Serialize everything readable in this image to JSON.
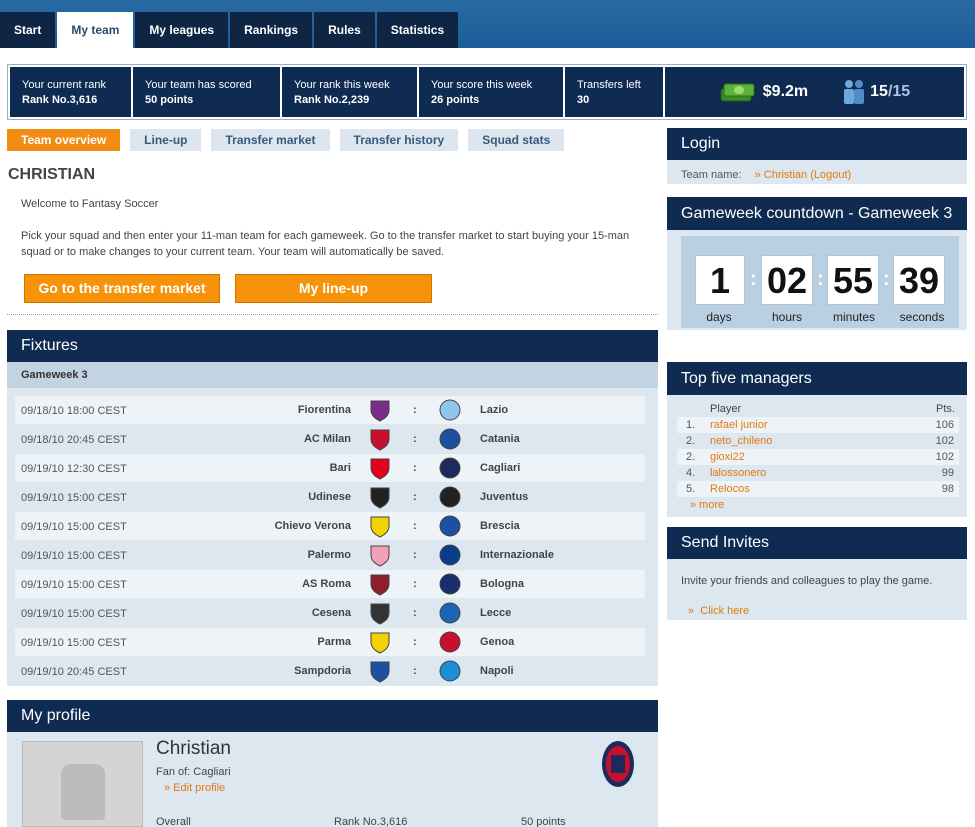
{
  "nav": {
    "tabs": [
      "Start",
      "My team",
      "My leagues",
      "Rankings",
      "Rules",
      "Statistics"
    ],
    "active": "My team"
  },
  "stats": {
    "current_rank_label": "Your current rank",
    "current_rank_value": "Rank No.3,616",
    "scored_label": "Your team has scored",
    "scored_value": "50 points",
    "week_rank_label": "Your rank this week",
    "week_rank_value": "Rank No.2,239",
    "week_score_label": "Your score this week",
    "week_score_value": "26 points",
    "transfers_label": "Transfers left",
    "transfers_value": "30",
    "money": "$9.2m",
    "squad_count": "15",
    "squad_max": "/15"
  },
  "subtabs": [
    "Team overview",
    "Line-up",
    "Transfer market",
    "Transfer history",
    "Squad stats"
  ],
  "team": {
    "name": "CHRISTIAN",
    "welcome": "Welcome to Fantasy Soccer",
    "intro": "Pick your squad and then enter your 11-man team for each gameweek. Go to the transfer market to start buying your 15-man squad or to make changes to your current team. Your team will automatically be saved.",
    "btn_transfer": "Go to the transfer market",
    "btn_lineup": "My line-up"
  },
  "fixtures": {
    "title": "Fixtures",
    "gameweek": "Gameweek 3",
    "rows": [
      {
        "date": "09/18/10 18:00 CEST",
        "home": "Fiorentina",
        "away": "Lazio",
        "hc": "#7b2d8e",
        "ac": "#8fc7ec"
      },
      {
        "date": "09/18/10 20:45 CEST",
        "home": "AC Milan",
        "away": "Catania",
        "hc": "#c8102e",
        "ac": "#1e4fa0"
      },
      {
        "date": "09/19/10 12:30 CEST",
        "home": "Bari",
        "away": "Cagliari",
        "hc": "#e2001a",
        "ac": "#1c2a5c"
      },
      {
        "date": "09/19/10 15:00 CEST",
        "home": "Udinese",
        "away": "Juventus",
        "hc": "#222222",
        "ac": "#222222"
      },
      {
        "date": "09/19/10 15:00 CEST",
        "home": "Chievo Verona",
        "away": "Brescia",
        "hc": "#f2d200",
        "ac": "#1e4fa0"
      },
      {
        "date": "09/19/10 15:00 CEST",
        "home": "Palermo",
        "away": "Internazionale",
        "hc": "#f4a0b8",
        "ac": "#0a3c8c"
      },
      {
        "date": "09/19/10 15:00 CEST",
        "home": "AS Roma",
        "away": "Bologna",
        "hc": "#8e1f2f",
        "ac": "#1a2e6b"
      },
      {
        "date": "09/19/10 15:00 CEST",
        "home": "Cesena",
        "away": "Lecce",
        "hc": "#333333",
        "ac": "#1d65b0"
      },
      {
        "date": "09/19/10 15:00 CEST",
        "home": "Parma",
        "away": "Genoa",
        "hc": "#f2d200",
        "ac": "#c8102e"
      },
      {
        "date": "09/19/10 20:45 CEST",
        "home": "Sampdoria",
        "away": "Napoli",
        "hc": "#1e4fa0",
        "ac": "#1a8fd6"
      }
    ]
  },
  "profile": {
    "title": "My profile",
    "name": "Christian",
    "fan_of": "Fan of: Cagliari",
    "edit": "» Edit profile",
    "overall_label": "Overall",
    "overall_rank": "Rank No.3,616",
    "overall_points": "50 points"
  },
  "login": {
    "title": "Login",
    "label": "Team name:",
    "value": "» Christian (Logout)"
  },
  "countdown": {
    "title": "Gameweek countdown - Gameweek 3",
    "days": "1",
    "hours": "02",
    "minutes": "55",
    "seconds": "39",
    "days_label": "days",
    "hours_label": "hours",
    "minutes_label": "minutes",
    "seconds_label": "seconds"
  },
  "managers": {
    "title": "Top five managers",
    "col_player": "Player",
    "col_pts": "Pts.",
    "rows": [
      {
        "num": "1.",
        "name": "rafael junior",
        "pts": "106"
      },
      {
        "num": "2.",
        "name": "neto_chileno",
        "pts": "102"
      },
      {
        "num": "2.",
        "name": "gioxi22",
        "pts": "102"
      },
      {
        "num": "4.",
        "name": "lalossonero",
        "pts": "99"
      },
      {
        "num": "5.",
        "name": "Relocos",
        "pts": "98"
      }
    ],
    "more": "» more"
  },
  "invites": {
    "title": "Send Invites",
    "text": "Invite your friends and colleagues to play the game.",
    "link": "Click here"
  },
  "colors": {
    "navy": "#0f2b52",
    "orange": "#f6930b",
    "panel": "#dce7f0"
  }
}
